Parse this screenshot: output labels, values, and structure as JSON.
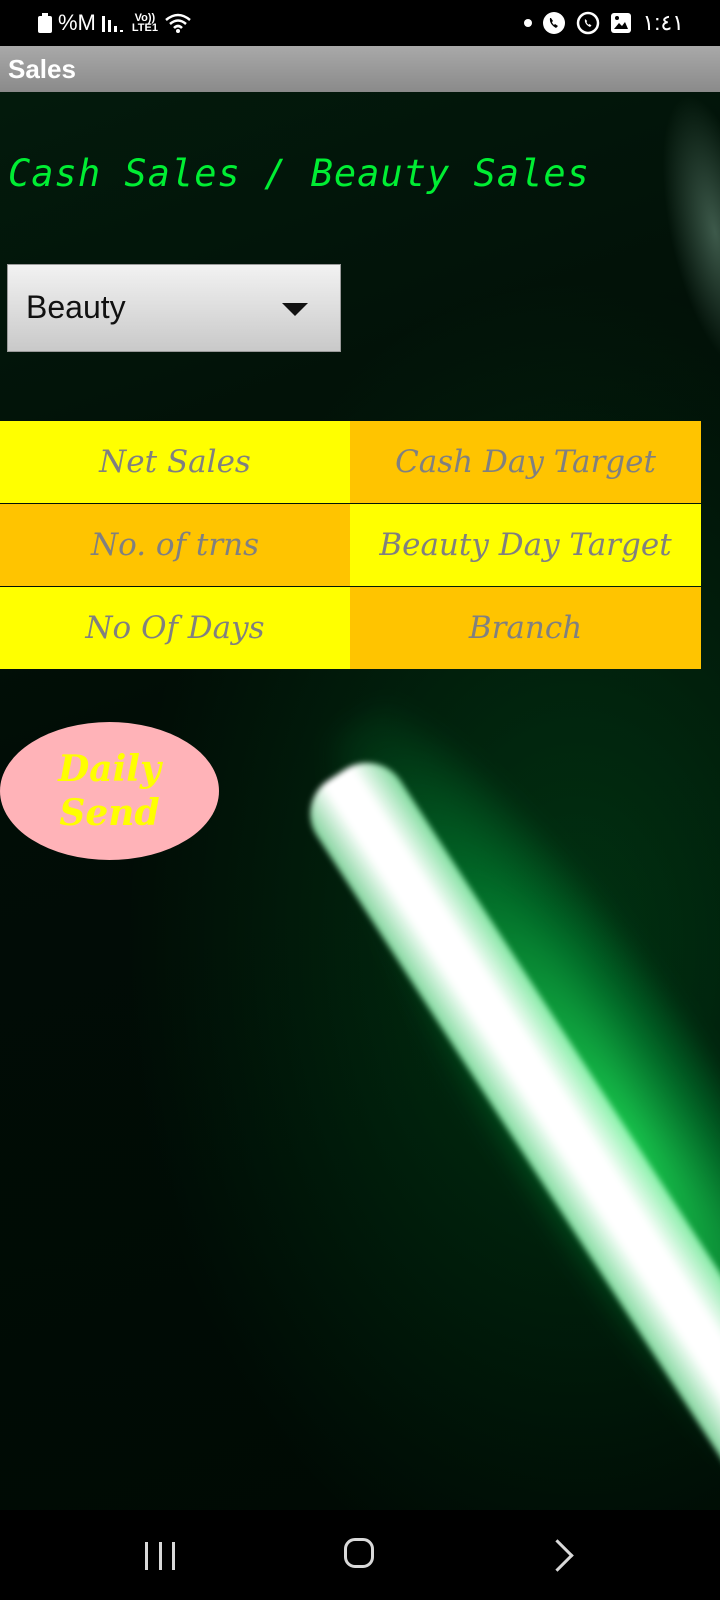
{
  "status_bar": {
    "battery_percent_text": "%M",
    "network_label_top": "Vo))",
    "network_label_bottom": "LTE1",
    "time": "١:٤١"
  },
  "app_bar": {
    "title": "Sales"
  },
  "heading": "Cash Sales / Beauty Sales",
  "dropdown": {
    "selected": "Beauty"
  },
  "table": {
    "rows": [
      {
        "left": "Net Sales",
        "right": "Cash Day Target"
      },
      {
        "left": "No. of trns",
        "right": "Beauty Day Target"
      },
      {
        "left": "No Of Days",
        "right": "Branch"
      }
    ]
  },
  "send_button": {
    "line1": "Daily",
    "line2": "Send"
  },
  "colors": {
    "heading_green": "#00ee33",
    "cell_yellow": "#ffff00",
    "cell_orange": "#ffc400",
    "button_pink": "#ffb3b8",
    "button_text_yellow": "#ffff00"
  },
  "icons": {
    "status": [
      "battery-icon",
      "signal-icon",
      "wifi-icon",
      "viber-icon",
      "whatsapp-icon",
      "gallery-icon"
    ],
    "navigation": [
      "recents-icon",
      "home-icon",
      "back-icon"
    ]
  }
}
